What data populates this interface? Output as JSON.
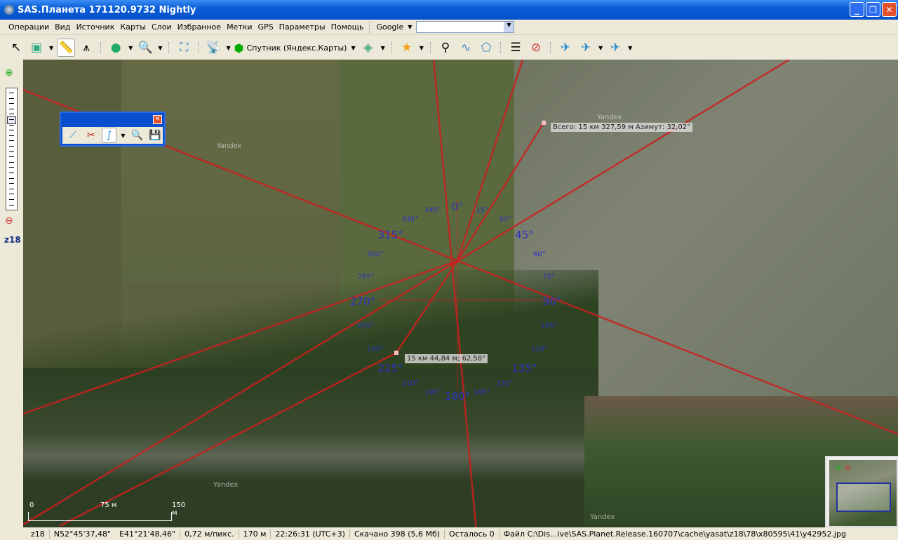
{
  "window": {
    "title": "SAS.Планета 171120.9732 Nightly",
    "min": "_",
    "max": "❐",
    "close": "✕"
  },
  "menu": [
    "Операции",
    "Вид",
    "Источник",
    "Карты",
    "Слои",
    "Избранное",
    "Метки",
    "GPS",
    "Параметры",
    "Помощь"
  ],
  "search": {
    "engine": "Google",
    "value": ""
  },
  "toolbar": {
    "map_type": "Спутник (Яндекс.Карты)"
  },
  "zoom": {
    "level": "z18",
    "slider_fraction": 0.75
  },
  "map": {
    "watermark": "Yandex",
    "total_tooltip": "Всего: 15 км 327,59 м Азимут: 32,02°",
    "segment_tooltip": "15 км 44,84 м; 62,58°",
    "angles": [
      "0°",
      "15°",
      "30°",
      "45°",
      "60°",
      "75°",
      "90°",
      "105°",
      "120°",
      "135°",
      "150°",
      "165°",
      "180°",
      "195°",
      "210°",
      "225°",
      "240°",
      "255°",
      "270°",
      "285°",
      "300°",
      "315°",
      "330°",
      "345°"
    ],
    "scale": {
      "zero": "0",
      "mid": "75 м",
      "end": "150 м"
    }
  },
  "status": {
    "zoom": "z18",
    "lat": "N52°45'37,48\"",
    "lon": "E41°21'48,46\"",
    "resolution": "0,72 м/пикс.",
    "distance": "170 м",
    "time": "22:26:31 (UTC+3)",
    "downloaded": "Скачано 398 (5,6 Мб)",
    "remaining": "Осталось 0",
    "file": "Файл C:\\Dis...ive\\SAS.Planet.Release.160707\\cache\\yasat\\z18\\78\\x80595\\41\\y42952.jpg"
  },
  "colors": {
    "line": "#cc1f1f",
    "angle_text": "#2d32c0"
  }
}
